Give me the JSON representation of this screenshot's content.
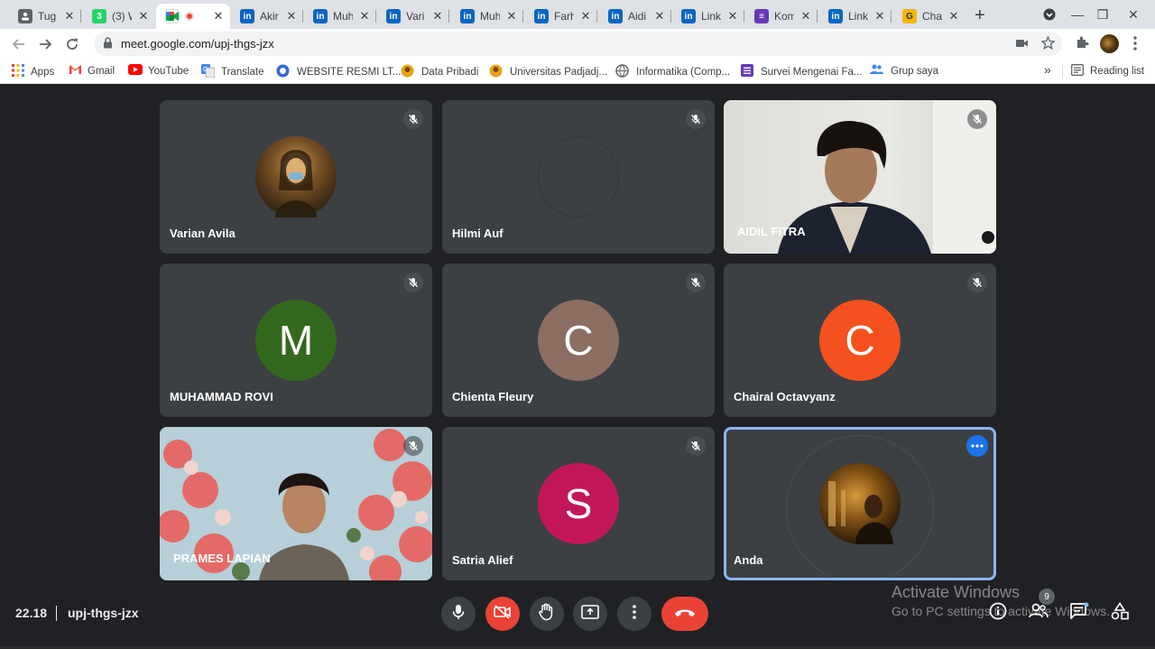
{
  "browser": {
    "tabs": [
      {
        "label": "Tug",
        "favicon": "doc-icon"
      },
      {
        "label": "(3) W",
        "favicon": "whatsapp-icon"
      },
      {
        "label": "",
        "favicon": "meet-icon",
        "active": true,
        "recording": true
      },
      {
        "label": "Akir",
        "favicon": "linkedin-icon"
      },
      {
        "label": "Muh",
        "favicon": "linkedin-icon"
      },
      {
        "label": "Vari",
        "favicon": "linkedin-icon"
      },
      {
        "label": "Muh",
        "favicon": "linkedin-icon"
      },
      {
        "label": "Farh",
        "favicon": "linkedin-icon"
      },
      {
        "label": "Aidi",
        "favicon": "linkedin-icon"
      },
      {
        "label": "Link",
        "favicon": "linkedin-icon"
      },
      {
        "label": "Kom",
        "favicon": "form-icon"
      },
      {
        "label": "Link",
        "favicon": "linkedin-icon"
      },
      {
        "label": "Cha",
        "favicon": "yellow-logo-icon"
      }
    ],
    "url": "meet.google.com/upj-thgs-jzx",
    "bookmarks": [
      {
        "label": "Apps",
        "icon": "apps-grid-icon"
      },
      {
        "label": "Gmail",
        "icon": "gmail-icon"
      },
      {
        "label": "YouTube",
        "icon": "youtube-icon"
      },
      {
        "label": "Translate",
        "icon": "translate-icon"
      },
      {
        "label": "WEBSITE RESMI LT...",
        "icon": "globe-logo-icon"
      },
      {
        "label": "Data Pribadi",
        "icon": "unpad-icon"
      },
      {
        "label": "Universitas Padjadj...",
        "icon": "unpad-icon"
      },
      {
        "label": "Informatika (Comp...",
        "icon": "globe-icon"
      },
      {
        "label": "Survei Mengenai Fa...",
        "icon": "form-icon"
      },
      {
        "label": "Grup saya",
        "icon": "group-icon"
      }
    ],
    "reading_list": "Reading list",
    "more_bookmarks": "»"
  },
  "meet": {
    "participants": [
      {
        "name": "Varian Avila",
        "avatar": "photo",
        "muted": true
      },
      {
        "name": "Hilmi Auf",
        "avatar": "none",
        "muted": true
      },
      {
        "name": "AIDIL FITRA",
        "avatar": "video",
        "muted": true
      },
      {
        "name": "MUHAMMAD ROVI",
        "initial": "M",
        "color": "#33691e",
        "muted": true
      },
      {
        "name": "Chienta Fleury",
        "initial": "C",
        "color": "#8d6e63",
        "muted": true
      },
      {
        "name": "Chairal Octavyanz",
        "initial": "C",
        "color": "#f4511e",
        "muted": true
      },
      {
        "name": "PRAMES LAPIAN",
        "avatar": "video",
        "muted": true
      },
      {
        "name": "Satria Alief",
        "initial": "S",
        "color": "#c2185b",
        "muted": true
      },
      {
        "name": "Anda",
        "avatar": "photo",
        "self": true
      }
    ],
    "time": "22.18",
    "meeting_code": "upj-thgs-jzx",
    "participant_count": "9",
    "controls": [
      "mic-icon",
      "camera-off-icon",
      "raise-hand-icon",
      "present-icon",
      "more-vert-icon",
      "hangup-icon"
    ]
  },
  "windows_watermark": {
    "title": "Activate Windows",
    "subtitle": "Go to PC settings to activate Windows."
  }
}
